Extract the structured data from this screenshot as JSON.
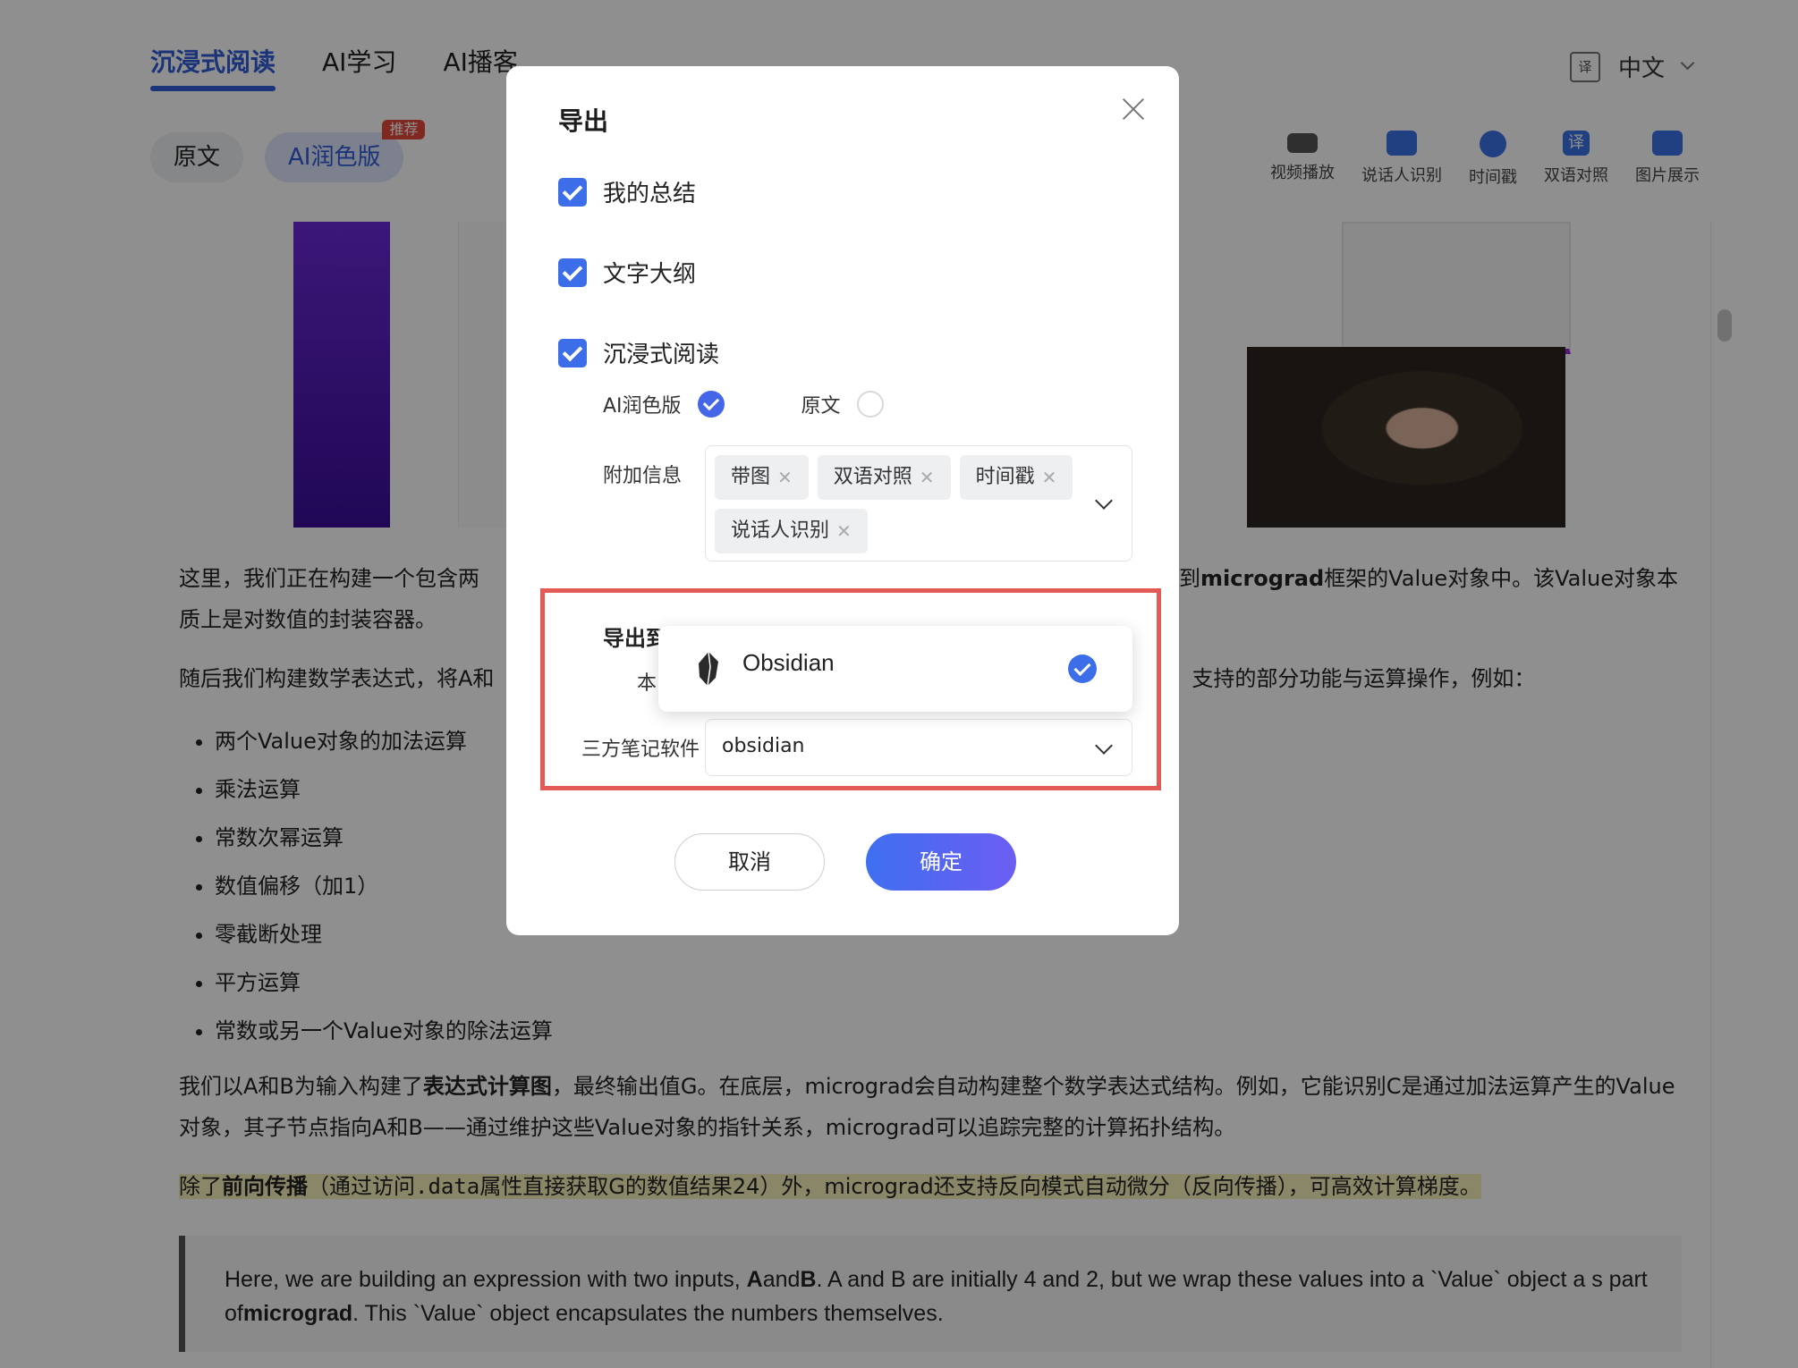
{
  "nav": {
    "tabs": [
      "沉浸式阅读",
      "AI学习",
      "AI播客"
    ],
    "language": "中文"
  },
  "versions": {
    "original": "原文",
    "ai": "AI润色版",
    "badge": "推荐"
  },
  "toolbar": {
    "items": [
      "视频播放",
      "说话人识别",
      "时间戳",
      "双语对照",
      "图片展示"
    ],
    "translate_glyph": "译"
  },
  "article": {
    "p1_a": "这里，我们正在构建一个包含两",
    "p1_b": "装到",
    "p1_bold": "micrograd",
    "p1_c": "框架的Value对象中。该Value对象本质上是对数值的封装容器。",
    "p2_a": "随后我们构建数学表达式，将A和",
    "p2_b": "支持的部分功能与运算操作，例如：",
    "bullets": [
      "两个Value对象的加法运算",
      "乘法运算",
      "常数次幂运算",
      "数值偏移（加1）",
      "零截断处理",
      "平方运算",
      "常数或另一个Value对象的除法运算"
    ],
    "p3_a": "我们以A和B为输入构建了",
    "p3_bold": "表达式计算图",
    "p3_b": "，最终输出值G。在底层，micrograd会自动构建整个数学表达式结构。例如，它能识别C是通过加法运算产生的Value对象，其子节点指向A和B——通过维护这些Value对象的指针关系，micrograd可以追踪完整的计算拓扑结构。",
    "p4_a": "除了",
    "p4_bold": "前向传播",
    "p4_b": "（通过访问",
    "p4_code": ".data",
    "p4_c": "属性直接获取G的数值结果24）外，micrograd还支持反向模式自动微分（反向传播），可高效计算梯度。",
    "quote_a": "Here, we are building an expression with two inputs, ",
    "quote_b1": "A",
    "quote_b2": "and",
    "quote_b3": "B",
    "quote_c": ". A and B are initially 4 and 2, but we wrap these values into a `Value` object a s part of",
    "quote_d": "micrograd",
    "quote_e": ". This `Value` object encapsulates the numbers themselves."
  },
  "modal": {
    "title": "导出",
    "checkboxes": [
      "我的总结",
      "文字大纲",
      "沉浸式阅读"
    ],
    "radio_ai": "AI润色版",
    "radio_original": "原文",
    "extra_label": "附加信息",
    "tags": [
      "带图",
      "双语对照",
      "时间戳",
      "说话人识别"
    ],
    "export_label": "导出到",
    "local_label": "本",
    "third_party_label": "三方笔记软件",
    "third_party_value": "obsidian",
    "dropdown_option": "Obsidian",
    "cancel": "取消",
    "confirm": "确定"
  },
  "colors": {
    "accent": "#3c6ee9",
    "highlight_frame": "#e35b57",
    "badge": "#e24a3b"
  }
}
